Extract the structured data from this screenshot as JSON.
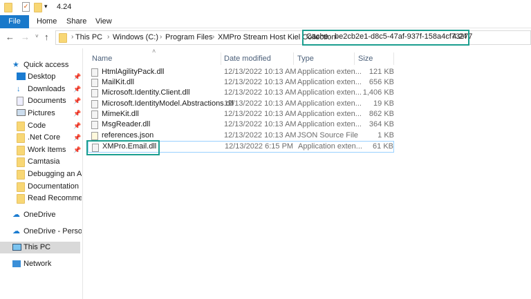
{
  "window": {
    "title": "4.24"
  },
  "ribbon": {
    "tabs": [
      "File",
      "Home",
      "Share",
      "View"
    ]
  },
  "address": {
    "crumbs": [
      "This PC",
      "Windows (C:)",
      "Program Files",
      "XMPro Stream Host Kiel Collection",
      "Cache",
      "be2cb2e1-d8c5-47af-937f-158a4cf73277",
      "4.24"
    ]
  },
  "columns": {
    "name": "Name",
    "date": "Date modified",
    "type": "Type",
    "size": "Size"
  },
  "files": [
    {
      "name": "HtmlAgilityPack.dll",
      "date": "12/13/2022 10:13 AM",
      "type": "Application exten...",
      "size": "121 KB"
    },
    {
      "name": "MailKit.dll",
      "date": "12/13/2022 10:13 AM",
      "type": "Application exten...",
      "size": "656 KB"
    },
    {
      "name": "Microsoft.Identity.Client.dll",
      "date": "12/13/2022 10:13 AM",
      "type": "Application exten...",
      "size": "1,406 KB"
    },
    {
      "name": "Microsoft.IdentityModel.Abstractions.dll",
      "date": "12/13/2022 10:13 AM",
      "type": "Application exten...",
      "size": "19 KB"
    },
    {
      "name": "MimeKit.dll",
      "date": "12/13/2022 10:13 AM",
      "type": "Application exten...",
      "size": "862 KB"
    },
    {
      "name": "MsgReader.dll",
      "date": "12/13/2022 10:13 AM",
      "type": "Application exten...",
      "size": "364 KB"
    },
    {
      "name": "references.json",
      "date": "12/13/2022 10:13 AM",
      "type": "JSON Source File",
      "size": "1 KB"
    },
    {
      "name": "XMPro.Email.dll",
      "date": "12/13/2022 6:15 PM",
      "type": "Application exten...",
      "size": "61 KB"
    }
  ],
  "sidebar": {
    "quick_access": "Quick access",
    "items": [
      "Desktop",
      "Downloads",
      "Documents",
      "Pictures",
      "Code",
      ".Net Core",
      "Work Items",
      "Camtasia",
      "Debugging an Agent",
      "Documentation",
      "Read Recommendations"
    ],
    "onedrive": "OneDrive",
    "onedrive_personal": "OneDrive - Personal",
    "this_pc": "This PC",
    "network": "Network"
  },
  "colors": {
    "accent": "#1979ca",
    "highlight": "#1a9e8f"
  }
}
